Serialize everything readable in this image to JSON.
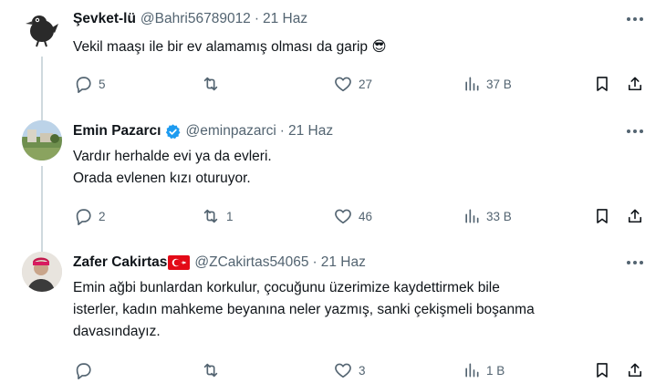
{
  "tweets": [
    {
      "name": "Şevket-lü",
      "handle": "@Bahri56789012",
      "separator": "·",
      "date": "21 Haz",
      "text_lines": [
        "Vekil maaşı ile bir ev alamamış olması da garip 😎"
      ],
      "replies": "5",
      "retweets": "",
      "likes": "27",
      "views": "37 B",
      "verified": false,
      "flag": false
    },
    {
      "name": "Emin Pazarcı",
      "handle": "@eminpazarci",
      "separator": "·",
      "date": "21 Haz",
      "text_lines": [
        "Vardır herhalde evi ya da evleri.",
        "Orada evlenen kızı oturuyor."
      ],
      "replies": "2",
      "retweets": "1",
      "likes": "46",
      "views": "33 B",
      "verified": true,
      "flag": false
    },
    {
      "name": "Zafer Cakirtas",
      "handle": "@ZCakirtas54065",
      "separator": "·",
      "date": "21 Haz",
      "text_lines": [
        "Emin ağbi bunlardan korkulur, çocuğunu üzerimize kaydettirmek bile",
        "isterler, kadın mahkeme beyanına neler yazmış, sanki çekişmeli boşanma",
        "davasındayız."
      ],
      "replies": "",
      "retweets": "",
      "likes": "3",
      "views": "1 B",
      "verified": false,
      "flag": true
    }
  ],
  "colors": {
    "text": "#0f1419",
    "secondary": "#536471",
    "verified": "#1d9bf0",
    "thread_line": "#cfd9de",
    "flag_red": "#e30a17"
  },
  "icons": [
    "reply-icon",
    "retweet-icon",
    "like-icon",
    "views-icon",
    "bookmark-icon",
    "share-icon",
    "more-icon",
    "verified-badge-icon",
    "turkey-flag-icon"
  ]
}
